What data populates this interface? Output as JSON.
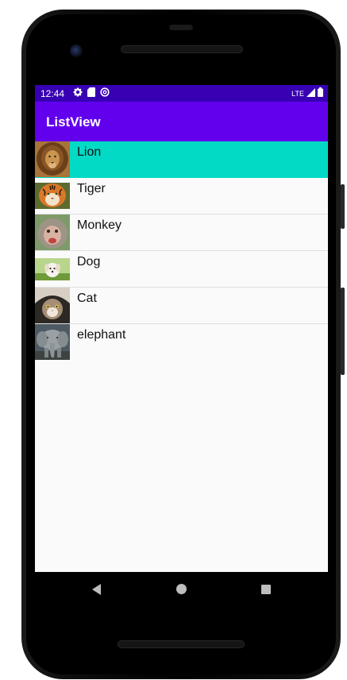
{
  "status_bar": {
    "time": "12:44",
    "network": "LTE",
    "icons": [
      "gear-icon",
      "sd-card-icon",
      "data-saver-icon",
      "signal-icon",
      "battery-icon"
    ]
  },
  "app_bar": {
    "title": "ListView"
  },
  "list": {
    "items": [
      {
        "label": "Lion",
        "thumbnail": "lion-image",
        "selected": true
      },
      {
        "label": "Tiger",
        "thumbnail": "tiger-image",
        "selected": false
      },
      {
        "label": "Monkey",
        "thumbnail": "monkey-image",
        "selected": false
      },
      {
        "label": "Dog",
        "thumbnail": "dog-image",
        "selected": false
      },
      {
        "label": "Cat",
        "thumbnail": "cat-image",
        "selected": false
      },
      {
        "label": "elephant",
        "thumbnail": "elephant-image",
        "selected": false
      }
    ]
  },
  "nav_bar": {
    "buttons": [
      "back-icon",
      "home-icon",
      "recents-icon"
    ]
  },
  "colors": {
    "status_bar": "#3700b3",
    "app_bar": "#6200ee",
    "selected_row": "#03dac5",
    "background": "#fafafa"
  }
}
